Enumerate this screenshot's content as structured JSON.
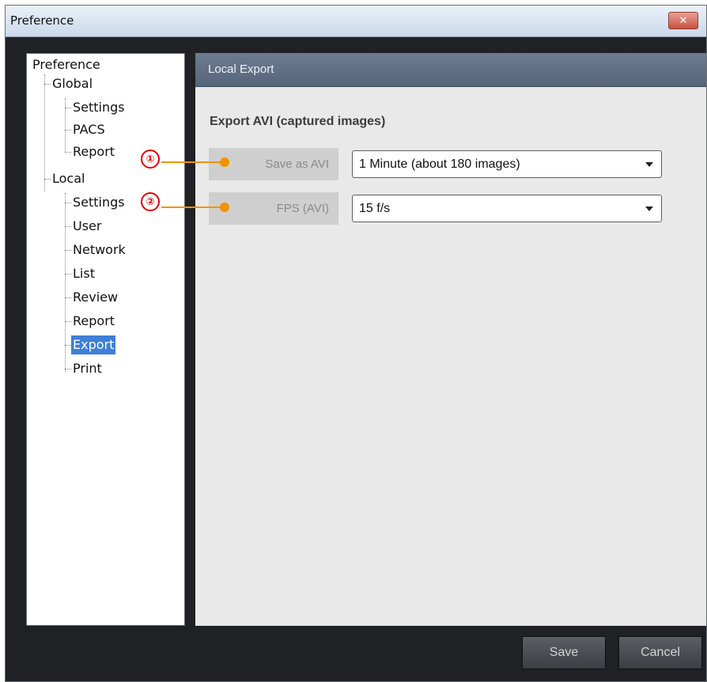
{
  "window": {
    "title": "Preference",
    "close_icon": "close-icon"
  },
  "tree": {
    "root": "Preference",
    "global": {
      "label": "Global",
      "children": [
        "Settings",
        "PACS",
        "Report"
      ]
    },
    "local": {
      "label": "Local",
      "children": [
        "Settings",
        "User",
        "Network",
        "List",
        "Review",
        "Report",
        "Export",
        "Print"
      ],
      "selected": "Export"
    }
  },
  "panel": {
    "header": "Local Export",
    "section_title": "Export AVI (captured images)",
    "fields": [
      {
        "label": "Save as AVI",
        "value": "1 Minute (about 180 images)",
        "annotation": "①"
      },
      {
        "label": "FPS (AVI)",
        "value": "15 f/s",
        "annotation": "②"
      }
    ]
  },
  "footer": {
    "save_label": "Save",
    "cancel_label": "Cancel"
  },
  "colors": {
    "annotation_red": "#e30000",
    "annotation_orange": "#f29200",
    "selection_blue": "#3f7fd6"
  }
}
